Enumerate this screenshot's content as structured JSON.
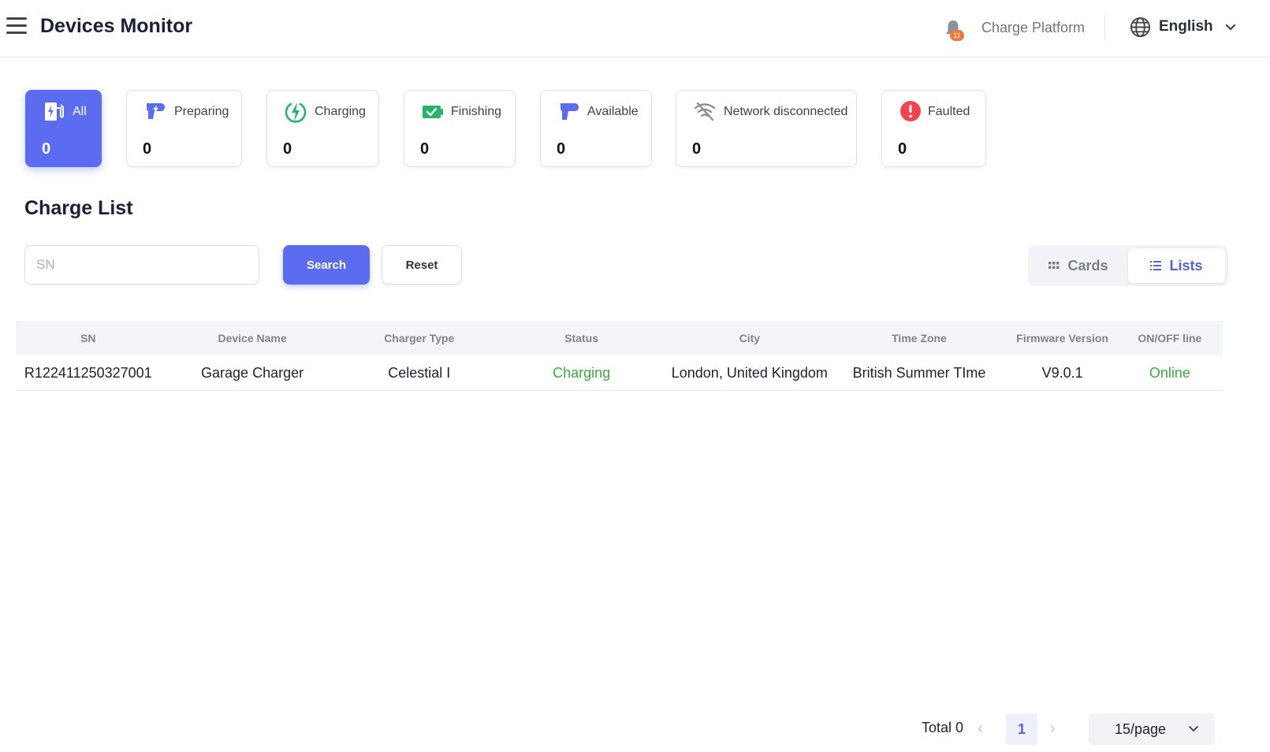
{
  "header": {
    "title": "Devices Monitor",
    "notification_count": "11",
    "platform": "Charge Platform",
    "language": "English"
  },
  "status_cards": [
    {
      "label": "All",
      "value": "0",
      "icon": "charger-station-icon",
      "active": true
    },
    {
      "label": "Preparing",
      "value": "0",
      "icon": "plug-bolt-icon"
    },
    {
      "label": "Charging",
      "value": "0",
      "icon": "lightning-circle-icon"
    },
    {
      "label": "Finishing",
      "value": "0",
      "icon": "battery-check-icon"
    },
    {
      "label": "Available",
      "value": "0",
      "icon": "plug-icon"
    },
    {
      "label": "Network disconnected",
      "value": "0",
      "icon": "wifi-off-icon"
    },
    {
      "label": "Faulted",
      "value": "0",
      "icon": "alert-circle-icon"
    }
  ],
  "charge_list": {
    "title": "Charge List",
    "search_placeholder": "SN",
    "search_label": "Search",
    "reset_label": "Reset",
    "view_cards": "Cards",
    "view_lists": "Lists"
  },
  "table": {
    "columns": [
      "SN",
      "Device Name",
      "Charger Type",
      "Status",
      "City",
      "Time Zone",
      "Firmware Version",
      "ON/OFF line"
    ],
    "rows": [
      [
        "R122411250327001",
        "Garage Charger",
        "Celestial I",
        "Charging",
        "London, United Kingdom",
        "British Summer TIme",
        "V9.0.1",
        "Online"
      ]
    ]
  },
  "pagination": {
    "total": "Total 0",
    "current_page": "1",
    "page_size": "15/page"
  },
  "colors": {
    "accent": "#5b6cf0",
    "status_green": "#3aae3a",
    "fault_red": "#f0454f",
    "charging_green": "#26b36b",
    "badge_orange": "#f37838"
  }
}
